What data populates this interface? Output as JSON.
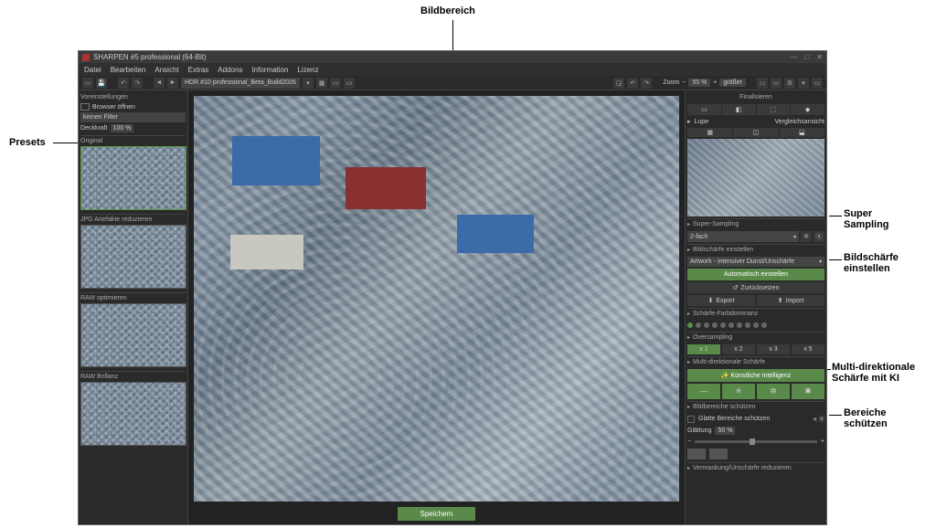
{
  "annotations": {
    "bildbereich": "Bildbereich",
    "presets": "Presets",
    "supersampling": "Super\nSampling",
    "bildschaerfe": "Bildschärfe\neinstellen",
    "multidir": "Multi-direktionale\nSchärfe mit KI",
    "bereiche": "Bereiche\nschützen"
  },
  "title": "SHARPEN #5 professional (64-Bit)",
  "menu": [
    "Datei",
    "Bearbeiten",
    "Ansicht",
    "Extras",
    "Addons",
    "Information",
    "Lizenz"
  ],
  "toolbar": {
    "path": "HDR #10 professional_Beta_Build2026"
  },
  "zoom": {
    "label": "Zoom",
    "value": "55 %",
    "compare": "größer"
  },
  "left": {
    "voreinstellungen": "Voreinstellungen",
    "browser": "Browser öffnen",
    "filter": "keinen Filter",
    "deckkraft_lbl": "Deckkraft",
    "deckkraft_val": "100 %",
    "sections": [
      "Original",
      "JPG Artefakte reduzieren",
      "RAW optimieren",
      "RAW Brillanz"
    ]
  },
  "save": "Speichern",
  "right": {
    "finalisieren": "Finalisieren",
    "lupe": "Lupe",
    "vergleich": "Vergleichsansicht",
    "supersampling": "Super-Sampling",
    "ss_val": "2-fach",
    "bildschaerfe": "Bildschärfe einstellen",
    "artwork": "Artwork - intensiver Dunst/Unschärfe",
    "auto": "Automatisch einstellen",
    "reset": "Zurücksetzen",
    "export": "Export",
    "import": "Import",
    "farbdominanz": "Schärfe-Farbdominanz",
    "oversampling": "Oversampling",
    "xlabels": [
      "x 1",
      "x 2",
      "x 3",
      "x 5"
    ],
    "multidir": "Multi-direktionale Schärfe",
    "ki": "Künstliche Intelligenz",
    "bildbereiche": "Bildbereiche schützen",
    "glatte": "Glatte Bereiche schützen",
    "glaettung_lbl": "Glättung",
    "glaettung_val": "50 %",
    "vermaskung": "Vermaskung/Unschärfe reduzieren"
  }
}
